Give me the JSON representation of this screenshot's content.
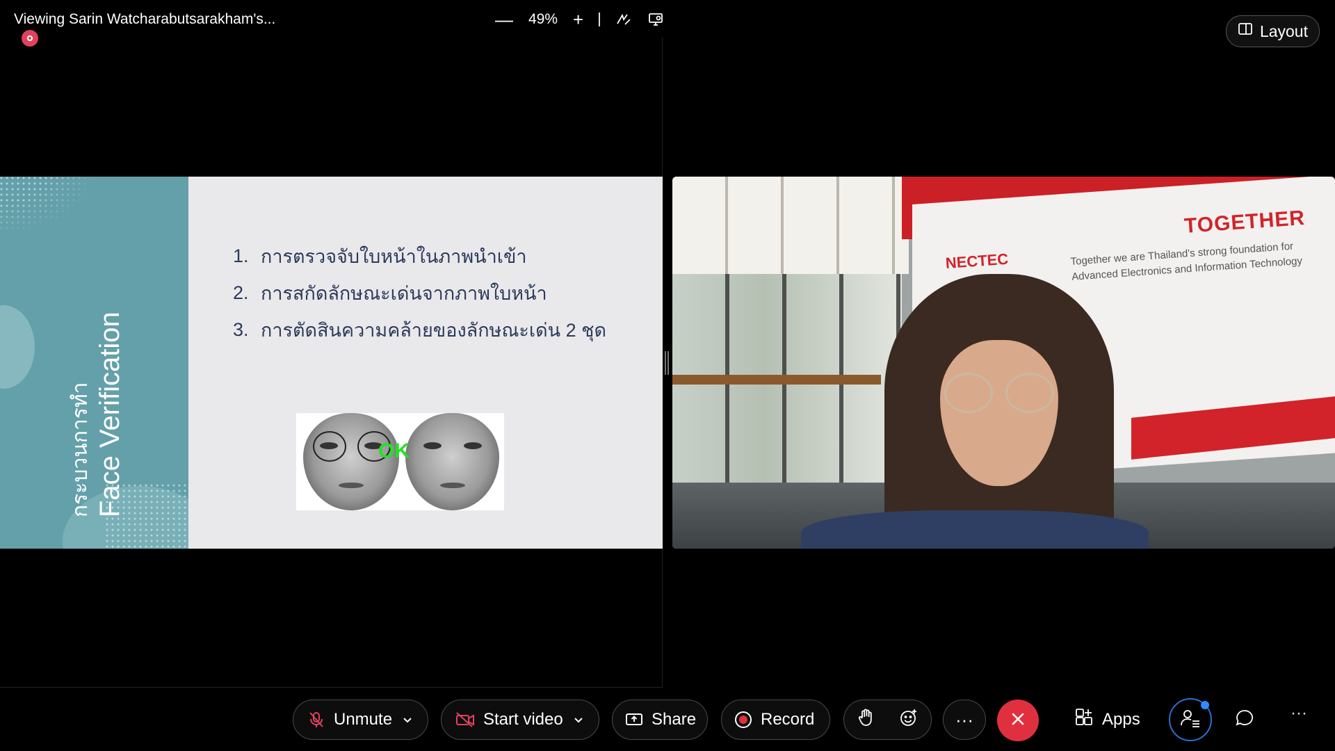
{
  "share": {
    "title": "Viewing Sarin Watcharabutsarakham's...",
    "zoom_out": "—",
    "zoom_pct": "49%",
    "zoom_in": "+"
  },
  "layout_button": {
    "label": "Layout"
  },
  "slide": {
    "side_thai": "กระบวนการทำ",
    "side_english": "Face Verification",
    "items": [
      {
        "num": "1.",
        "text": "การตรวจจับใบหน้าในภาพนำเข้า"
      },
      {
        "num": "2.",
        "text": "การสกัดลักษณะเด่นจากภาพใบหน้า"
      },
      {
        "num": "3.",
        "text": "การตัดสินความคล้ายของลักษณะเด่น 2 ชุด"
      }
    ],
    "ok_label": "OK"
  },
  "camera": {
    "brand_nectec": "NECTEC",
    "brand_together": "TOGETHER",
    "tagline_line1": "Together we are Thailand's strong foundation for",
    "tagline_line2": "Advanced Electronics and Information Technology"
  },
  "toolbar": {
    "unmute_label": "Unmute",
    "video_label": "Start video",
    "share_label": "Share",
    "record_label": "Record",
    "more_label": "···",
    "apps_label": "Apps",
    "overflow_label": "···"
  },
  "colors": {
    "slide_side": "#64a0aa",
    "slide_text": "#2d3a5a",
    "end_call": "#e0303f",
    "recording": "#e0425e",
    "accent": "#2f6fd3"
  },
  "icons": {
    "record_indicator": "recording-indicator-icon",
    "annotate": "annotate-icon",
    "screen": "screen-control-icon",
    "layout": "layout-icon",
    "mic_off": "mic-off-icon",
    "video_off": "video-off-icon",
    "share": "share-screen-icon",
    "record": "record-icon",
    "hand": "raise-hand-icon",
    "reaction": "reaction-icon",
    "end": "end-call-icon",
    "apps": "apps-icon",
    "participants": "participants-icon",
    "chat": "chat-icon"
  }
}
